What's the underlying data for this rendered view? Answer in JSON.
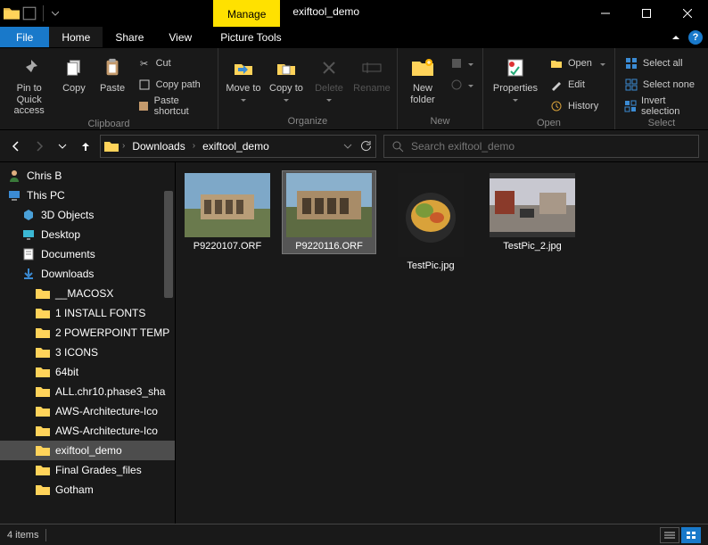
{
  "title": "exiftool_demo",
  "contextual_tab": "Manage",
  "tabs": {
    "file": "File",
    "home": "Home",
    "share": "Share",
    "view": "View",
    "picture_tools": "Picture Tools"
  },
  "ribbon": {
    "clipboard": {
      "label": "Clipboard",
      "pin": "Pin to Quick access",
      "copy": "Copy",
      "paste": "Paste",
      "cut": "Cut",
      "copy_path": "Copy path",
      "paste_shortcut": "Paste shortcut"
    },
    "organize": {
      "label": "Organize",
      "move_to": "Move to",
      "copy_to": "Copy to",
      "delete": "Delete",
      "rename": "Rename"
    },
    "new": {
      "label": "New",
      "new_folder": "New folder"
    },
    "open": {
      "label": "Open",
      "properties": "Properties",
      "open": "Open",
      "edit": "Edit",
      "history": "History"
    },
    "select": {
      "label": "Select",
      "all": "Select all",
      "none": "Select none",
      "invert": "Invert selection"
    }
  },
  "breadcrumb": {
    "seg1": "Downloads",
    "seg2": "exiftool_demo"
  },
  "search_placeholder": "Search exiftool_demo",
  "navpane": {
    "user": "Chris B",
    "this_pc": "This PC",
    "items": [
      "3D Objects",
      "Desktop",
      "Documents",
      "Downloads"
    ],
    "downloads_children": [
      "__MACOSX",
      "1 INSTALL FONTS",
      "2 POWERPOINT TEMP",
      "3 ICONS",
      "64bit",
      "ALL.chr10.phase3_sha",
      "AWS-Architecture-Ico",
      "AWS-Architecture-Ico",
      "exiftool_demo",
      "Final Grades_files",
      "Gotham"
    ]
  },
  "files": [
    {
      "name": "P9220107.ORF",
      "selected": false,
      "orient": "landscape"
    },
    {
      "name": "P9220116.ORF",
      "selected": true,
      "orient": "landscape"
    },
    {
      "name": "TestPic.jpg",
      "selected": false,
      "orient": "portrait"
    },
    {
      "name": "TestPic_2.jpg",
      "selected": false,
      "orient": "landscape"
    }
  ],
  "status": {
    "count": "4 items"
  }
}
